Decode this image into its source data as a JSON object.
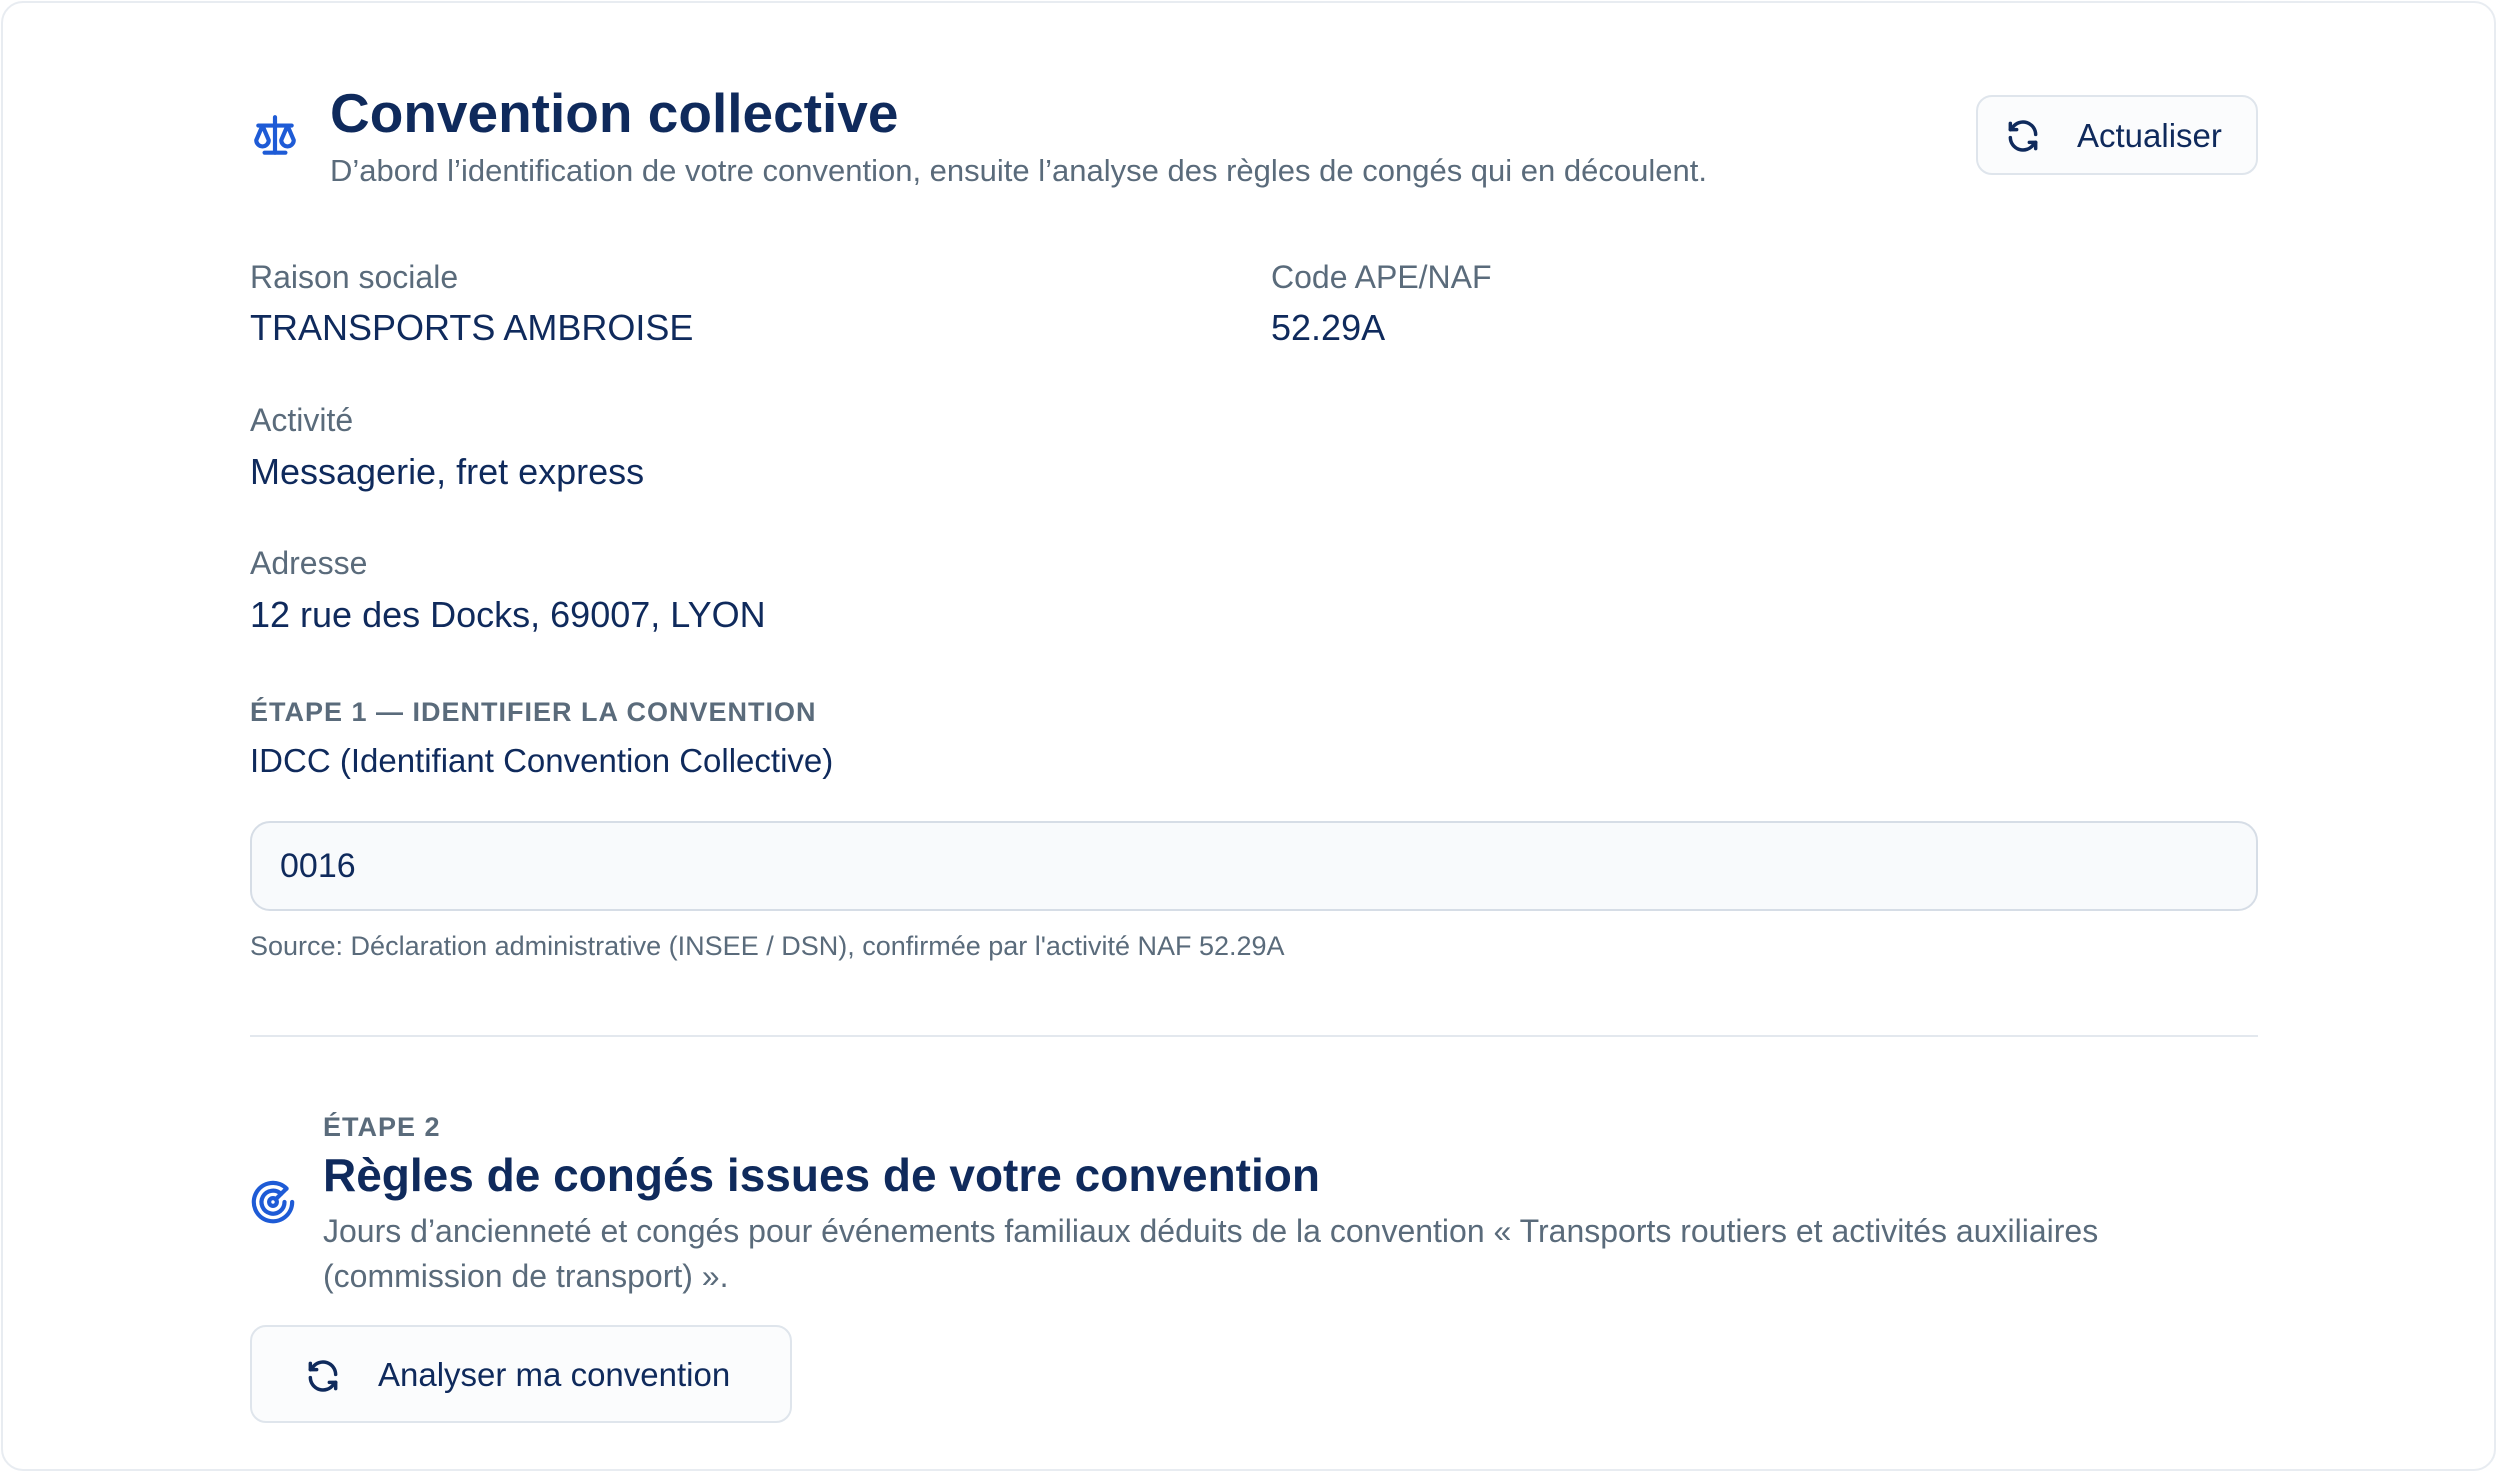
{
  "header": {
    "title": "Convention collective",
    "subtitle": "D’abord l’identification de votre convention, ensuite l’analyse des règles de congés qui en découlent.",
    "icon": "scale-icon",
    "refresh_label": "Actualiser",
    "refresh_icon": "refresh-icon"
  },
  "company": {
    "raison_sociale": {
      "label": "Raison sociale",
      "value": "TRANSPORTS AMBROISE"
    },
    "code_ape": {
      "label": "Code APE/NAF",
      "value": "52.29A"
    },
    "activite": {
      "label": "Activité",
      "value": "Messagerie, fret express"
    },
    "adresse": {
      "label": "Adresse",
      "value": "12 rue des Docks, 69007, LYON"
    }
  },
  "step1": {
    "label": "ÉTAPE 1 — IDENTIFIER LA CONVENTION",
    "field_label": "IDCC (Identifiant Convention Collective)",
    "idcc_value": "0016",
    "source": "Source: Déclaration administrative (INSEE / DSN), confirmée par l'activité NAF 52.29A"
  },
  "step2": {
    "label": "ÉTAPE 2",
    "title": "Règles de congés issues de votre convention",
    "description": "Jours d’ancienneté et congés pour événements familiaux déduits de la convention « Transports routiers et activités auxiliaires (commission de transport) ».",
    "icon": "radar-icon",
    "button_label": "Analyser ma convention",
    "button_icon": "refresh-icon"
  },
  "colors": {
    "primary_text": "#0f2a5c",
    "muted_text": "#5a6b7b",
    "accent_icon": "#1e5bd6",
    "border": "#dfe5ec"
  }
}
